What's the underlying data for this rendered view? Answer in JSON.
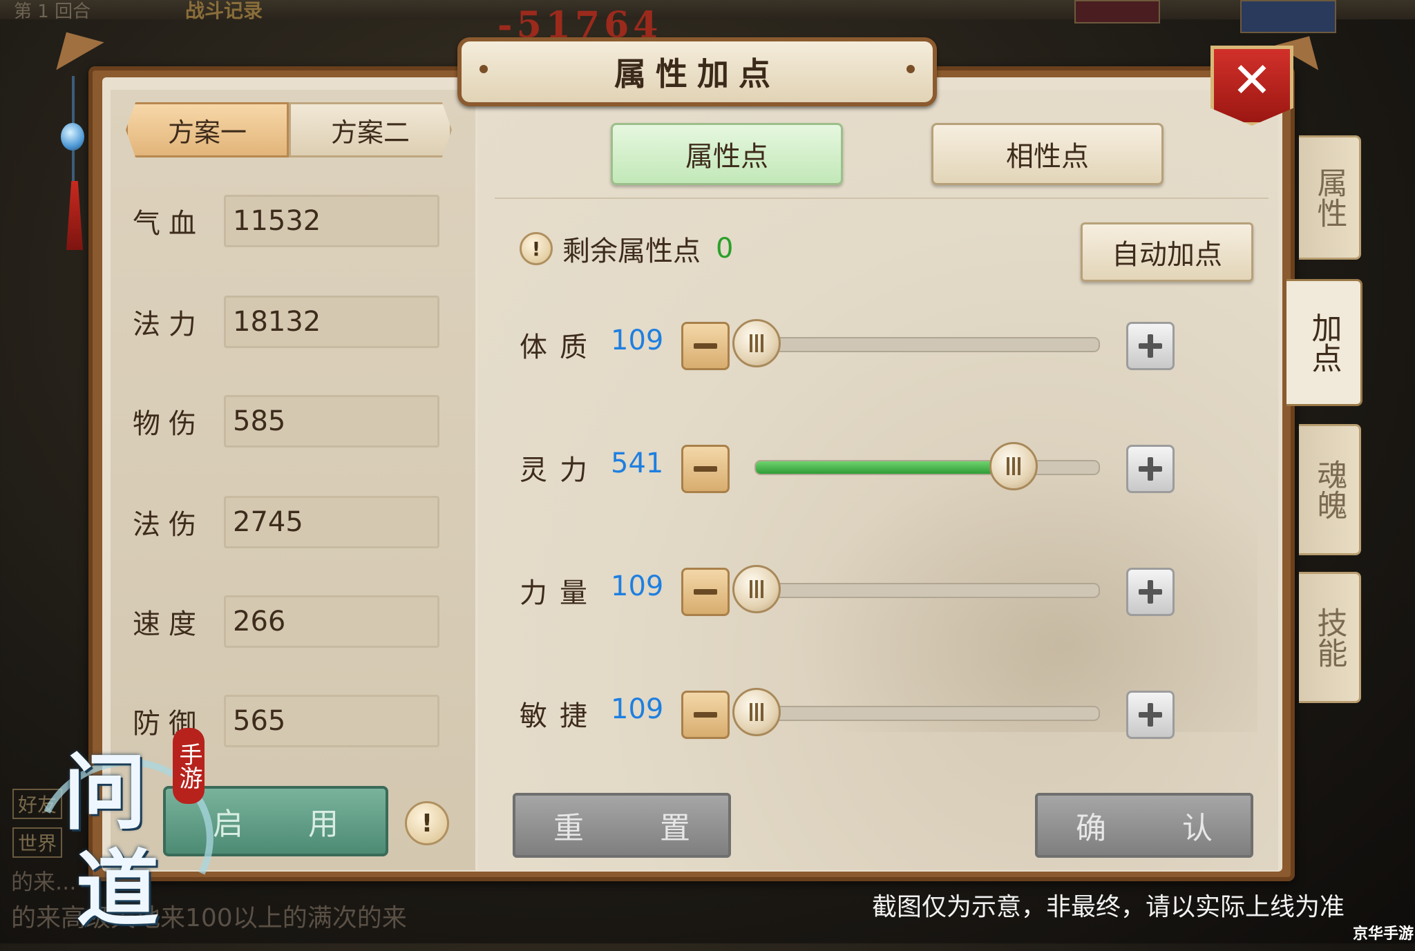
{
  "background": {
    "top_label": "第 1 回合",
    "battle_record": "战斗记录",
    "damage_number": "-51764",
    "friend_tag": "好友",
    "world_tag": "世界",
    "chat_line1": "的来...",
    "chat_line2": "的来高级天地来100以上的满次的来"
  },
  "window": {
    "title": "属性加点",
    "close_label": "✕"
  },
  "plans": {
    "tabs": [
      {
        "label": "方案一",
        "active": true
      },
      {
        "label": "方案二",
        "active": false
      }
    ]
  },
  "stats": [
    {
      "label": "气血",
      "value": "11532"
    },
    {
      "label": "法力",
      "value": "18132"
    },
    {
      "label": "物伤",
      "value": "585"
    },
    {
      "label": "法伤",
      "value": "2745"
    },
    {
      "label": "速度",
      "value": "266"
    },
    {
      "label": "防御",
      "value": "565"
    }
  ],
  "enable_button": "启 用",
  "info_icon": "!",
  "attribute_tabs": [
    {
      "label": "属性点",
      "active": true
    },
    {
      "label": "相性点",
      "active": false
    }
  ],
  "remaining": {
    "label": "剩余属性点",
    "value": "0"
  },
  "auto_button": "自动加点",
  "sliders": [
    {
      "label": "体质",
      "value": "109",
      "fill": 0.0
    },
    {
      "label": "灵力",
      "value": "541",
      "fill": 0.75
    },
    {
      "label": "力量",
      "value": "109",
      "fill": 0.0
    },
    {
      "label": "敏捷",
      "value": "109",
      "fill": 0.0
    }
  ],
  "actions": {
    "reset": "重 置",
    "confirm": "确 认"
  },
  "side_tabs": [
    {
      "label": "属性",
      "active": false
    },
    {
      "label": "加点",
      "active": true
    },
    {
      "label": "魂魄",
      "active": false
    },
    {
      "label": "技能",
      "active": false
    }
  ],
  "footer": {
    "disclaimer": "截图仅为示意，非最终，请以实际上线为准",
    "brand": "京华手游"
  },
  "logo": {
    "char1": "问",
    "char2": "道",
    "seal": "手游"
  },
  "colors": {
    "value_blue": "#1e7fe0",
    "remaining_green": "#2aa02a",
    "active_tab_green": "#c2e8b8",
    "close_red": "#c32620",
    "slider_fill_green": "#2f9c35"
  }
}
